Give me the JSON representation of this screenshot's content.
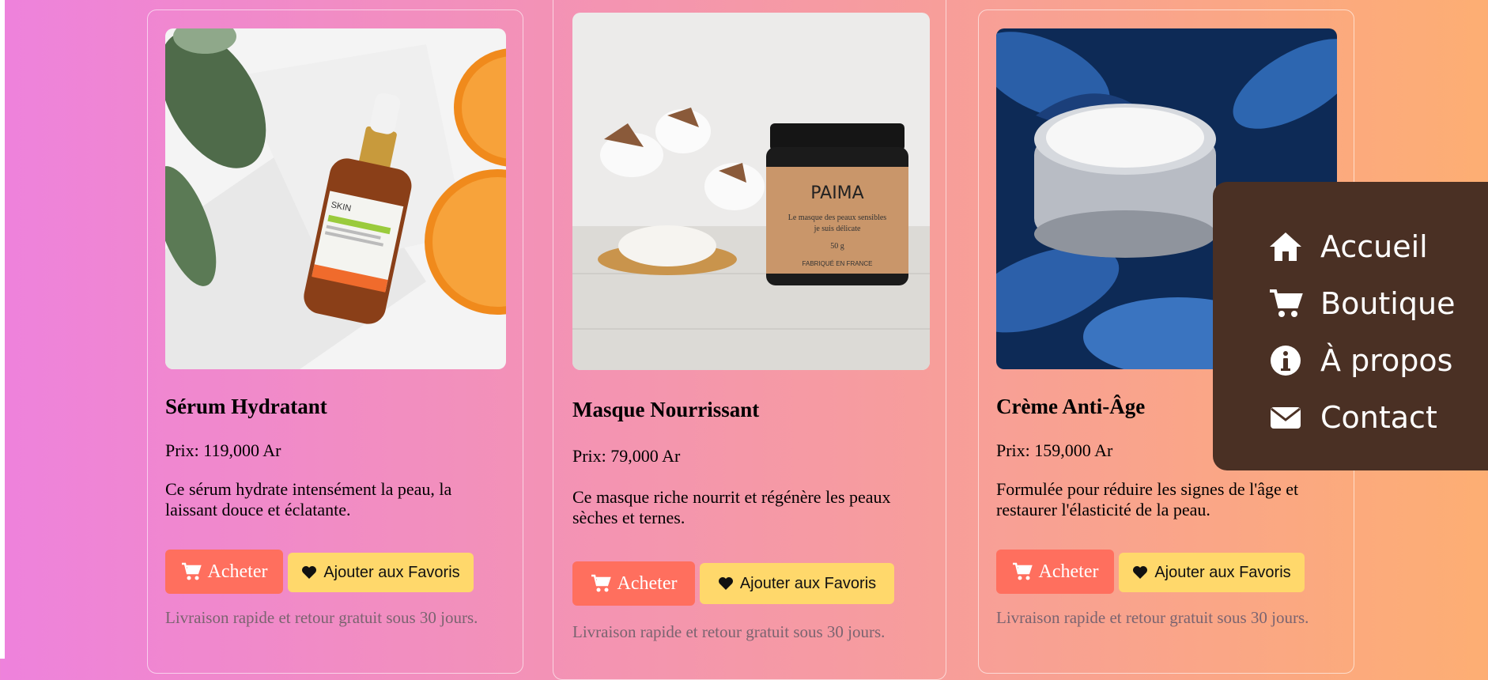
{
  "products": [
    {
      "title": "Sérum Hydratant",
      "price": "Prix: 119,000 Ar",
      "description": "Ce sérum hydrate intensément la peau, la laissant douce et éclatante.",
      "buy_label": "Acheter",
      "fav_label": "Ajouter aux Favoris",
      "note": "Livraison rapide et retour gratuit sous 30 jours."
    },
    {
      "title": "Masque Nourrissant",
      "price": "Prix: 79,000 Ar",
      "description": "Ce masque riche nourrit et régénère les peaux sèches et ternes.",
      "buy_label": "Acheter",
      "fav_label": "Ajouter aux Favoris",
      "note": "Livraison rapide et retour gratuit sous 30 jours."
    },
    {
      "title": "Crème Anti-Âge",
      "price": "Prix: 159,000 Ar",
      "description": "Formulée pour réduire les signes de l'âge et restaurer l'élasticité de la peau.",
      "buy_label": "Acheter",
      "fav_label": "Ajouter aux Favoris",
      "note": "Livraison rapide et retour gratuit sous 30 jours."
    }
  ],
  "jar_label": {
    "brand": "PAIMA",
    "line1": "Le masque des peaux sensibles",
    "line2": "je suis délicate",
    "weight": "50 g",
    "origin": "FABRIQUÉ EN FRANCE"
  },
  "bottle_label": {
    "brand": "SKIN"
  },
  "menu": {
    "items": [
      {
        "label": "Accueil",
        "icon": "home-icon"
      },
      {
        "label": "Boutique",
        "icon": "cart-icon"
      },
      {
        "label": "À propos",
        "icon": "info-icon"
      },
      {
        "label": "Contact",
        "icon": "envelope-icon"
      }
    ]
  },
  "colors": {
    "buy_button": "#ff6f5e",
    "fav_button": "#ffd86b",
    "menu_bg": "#4a3024"
  }
}
